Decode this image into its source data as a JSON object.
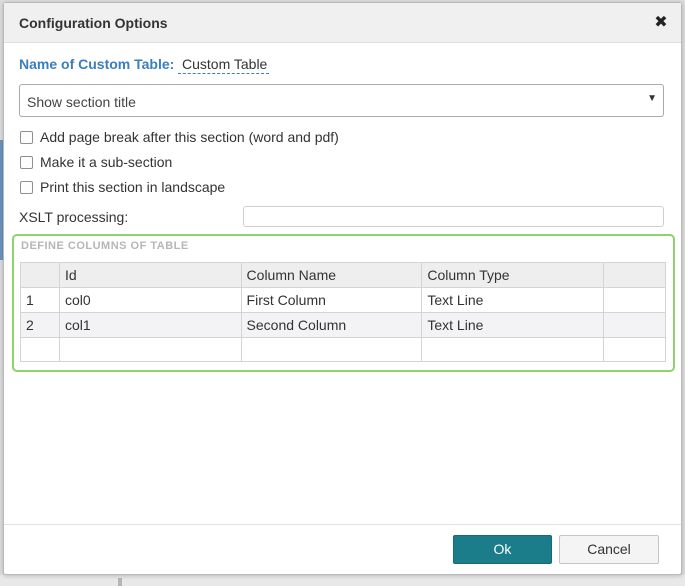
{
  "dialog": {
    "title": "Configuration Options",
    "close_glyph": "✖"
  },
  "name_field": {
    "label": "Name of Custom Table:",
    "value": "Custom Table"
  },
  "section_title_select": {
    "value": "Show section title",
    "arrow_glyph": "▼"
  },
  "options": [
    {
      "label": "Add page break after this section (word and pdf)",
      "checked": false
    },
    {
      "label": "Make it a sub-section",
      "checked": false
    },
    {
      "label": "Print this section in landscape",
      "checked": false
    }
  ],
  "xslt": {
    "label": "XSLT processing:",
    "value": ""
  },
  "columns_panel": {
    "title": "DEFINE COLUMNS OF TABLE",
    "headers": [
      "",
      "Id",
      "Column Name",
      "Column Type",
      ""
    ],
    "rows": [
      [
        "1",
        "col0",
        "First Column",
        "Text Line",
        ""
      ],
      [
        "2",
        "col1",
        "Second Column",
        "Text Line",
        ""
      ]
    ]
  },
  "buttons": {
    "ok": "Ok",
    "cancel": "Cancel"
  },
  "colors": {
    "accent_blue": "#3a7ebf",
    "primary_button": "#1b7d8a",
    "panel_border": "#8fd16a"
  }
}
